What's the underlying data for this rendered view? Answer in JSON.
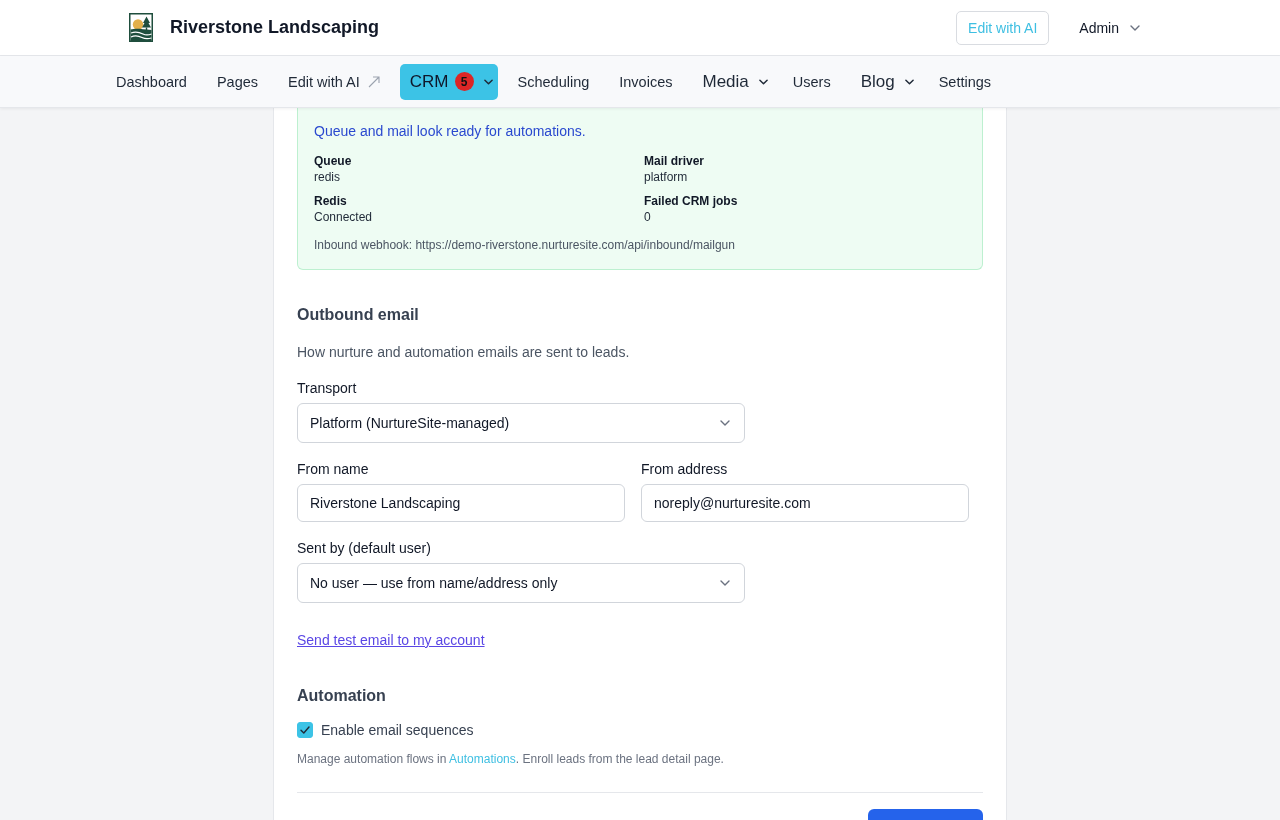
{
  "header": {
    "brand": "Riverstone Landscaping",
    "edit_button": "Edit with AI",
    "user_menu": "Admin"
  },
  "nav": [
    {
      "label": "Dashboard",
      "kind": "link",
      "selected": false
    },
    {
      "label": "Pages",
      "kind": "link",
      "selected": false
    },
    {
      "label": "Edit with AI",
      "kind": "external",
      "selected": false
    },
    {
      "label": "CRM",
      "kind": "menu",
      "selected": true,
      "badge": "5"
    },
    {
      "label": "Scheduling",
      "kind": "link",
      "selected": false
    },
    {
      "label": "Invoices",
      "kind": "link",
      "selected": false
    },
    {
      "label": "Media",
      "kind": "menu",
      "selected": false
    },
    {
      "label": "Users",
      "kind": "link",
      "selected": false
    },
    {
      "label": "Blog",
      "kind": "menu",
      "selected": false
    },
    {
      "label": "Settings",
      "kind": "link",
      "selected": false
    }
  ],
  "status_panel": {
    "message": "Queue and mail look ready for automations.",
    "fields": [
      {
        "label": "Queue",
        "value": "redis"
      },
      {
        "label": "Mail driver",
        "value": "platform"
      },
      {
        "label": "Redis",
        "value": "Connected"
      },
      {
        "label": "Failed CRM jobs",
        "value": "0"
      }
    ],
    "webhook": "Inbound webhook: https://demo-riverstone.nurturesite.com/api/inbound/mailgun"
  },
  "outbound_email": {
    "title": "Outbound email",
    "description": "How nurture and automation emails are sent to leads.",
    "fields": [
      {
        "kind": "select",
        "label": "Transport",
        "value": "Platform (NurtureSite-managed)"
      },
      {
        "kind": "text",
        "label": "From name",
        "value": "Riverstone Landscaping"
      },
      {
        "kind": "text",
        "label": "From address",
        "value": "noreply@nurturesite.com"
      },
      {
        "kind": "select",
        "label": "Sent by (default user)",
        "value": "No user — use from name/address only"
      }
    ],
    "test_link": "Send test email to my account"
  },
  "automation": {
    "title": "Automation",
    "checkbox": {
      "label": "Enable email sequences",
      "checked": true
    },
    "help_before": "Manage automation flows in ",
    "help_link": "Automations",
    "help_after": ". Enroll leads from the lead detail page."
  }
}
